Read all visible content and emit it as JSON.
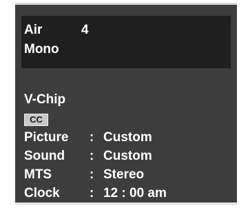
{
  "channel": {
    "source": "Air",
    "number": "4",
    "audio": "Mono"
  },
  "vchip_label": "V-Chip",
  "cc_badge": "CC",
  "settings": [
    {
      "label": "Picture",
      "sep": ":",
      "value": "Custom"
    },
    {
      "label": "Sound",
      "sep": ":",
      "value": "Custom"
    },
    {
      "label": "MTS",
      "sep": ":",
      "value": "Stereo"
    },
    {
      "label": "Clock",
      "sep": ":",
      "value": "12 : 00 am"
    }
  ],
  "colors": {
    "panel": "#3d3d3d",
    "channel_box": "#1f1f1f",
    "text": "#ffffff",
    "badge": "#c8c8c8"
  }
}
